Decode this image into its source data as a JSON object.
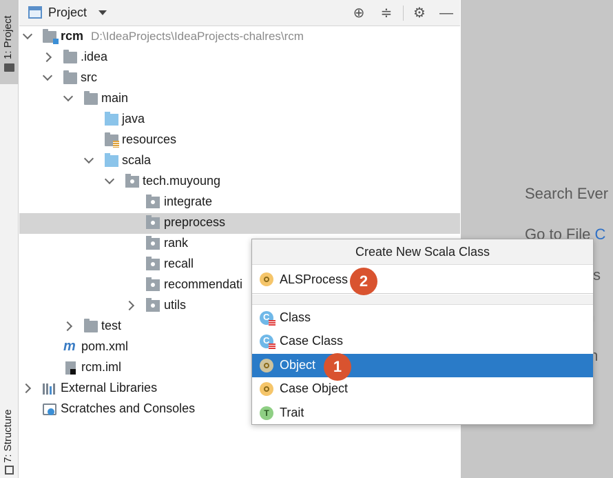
{
  "tool_strip": {
    "project_tab": "1: Project",
    "structure_tab": "7: Structure"
  },
  "panel": {
    "title": "Project",
    "icons": [
      "locate-icon",
      "collapse-icon",
      "gear-icon",
      "minimize-icon"
    ]
  },
  "tree": {
    "root_name": "rcm",
    "root_path": "D:\\IdeaProjects\\IdeaProjects-chalres\\rcm",
    "idea": ".idea",
    "src": "src",
    "main": "main",
    "java": "java",
    "resources": "resources",
    "scala": "scala",
    "package": "tech.muyoung",
    "integrate": "integrate",
    "preprocess": "preprocess",
    "rank": "rank",
    "recall": "recall",
    "recommendation": "recommendati",
    "utils": "utils",
    "test": "test",
    "pom": "pom.xml",
    "iml": "rcm.iml",
    "external": "External Libraries",
    "scratches": "Scratches and Consoles"
  },
  "editor_hints": {
    "search": "Search Ever",
    "goto_file": "Go to File",
    "goto_key": "C",
    "recent": "iles",
    "nav": "on",
    "drop": "s h"
  },
  "popup": {
    "title": "Create New Scala Class",
    "name_value": "ALSProcess",
    "kinds": [
      "Class",
      "Case Class",
      "Object",
      "Case Object",
      "Trait"
    ],
    "selected_kind": "Object"
  },
  "badges": {
    "step1": "1",
    "step2": "2"
  }
}
